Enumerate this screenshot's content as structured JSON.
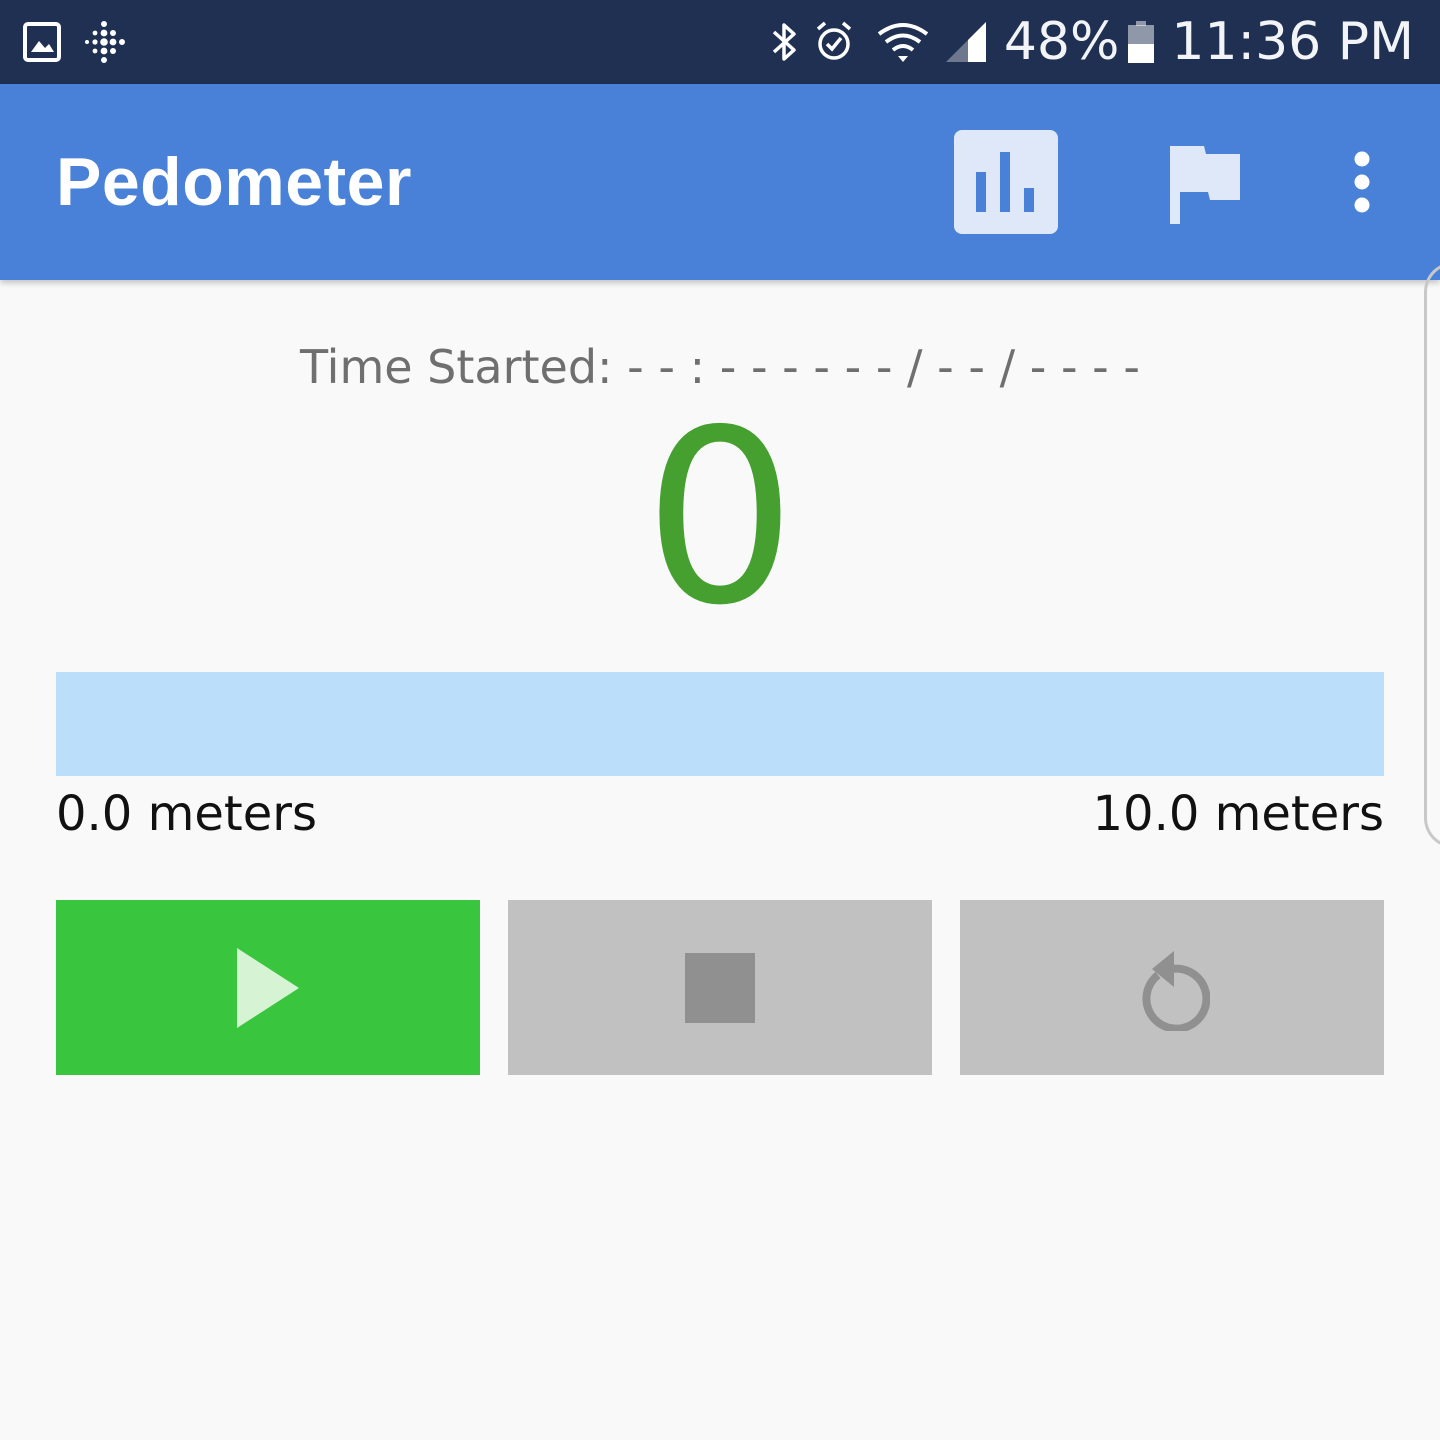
{
  "status_bar": {
    "battery_percent": "48%",
    "time": "11:36 PM",
    "icons": [
      "gallery-icon",
      "fitbit-icon",
      "bluetooth-icon",
      "alarm-icon",
      "wifi-icon",
      "cell-signal-icon",
      "battery-icon"
    ]
  },
  "app_bar": {
    "title": "Pedometer",
    "actions": [
      "chart-icon",
      "flag-icon",
      "more-vert-icon"
    ]
  },
  "tracker": {
    "time_started": "Time Started: - - : - -  - -  - - / - - / - - - -",
    "step_count": "0",
    "progress_fraction": 0.0,
    "distance_current": "0.0 meters",
    "distance_goal": "10.0 meters"
  },
  "controls": {
    "play": {
      "icon": "play-icon",
      "enabled": true
    },
    "stop": {
      "icon": "stop-icon",
      "enabled": false
    },
    "reset": {
      "icon": "reset-icon",
      "enabled": false
    }
  },
  "colors": {
    "status_bar": "#1f3052",
    "app_bar": "#4a81d8",
    "step_count": "#46a02f",
    "progress_track": "#bbdefa",
    "play_button": "#3ac53f",
    "disabled_button": "#c1c1c1"
  }
}
